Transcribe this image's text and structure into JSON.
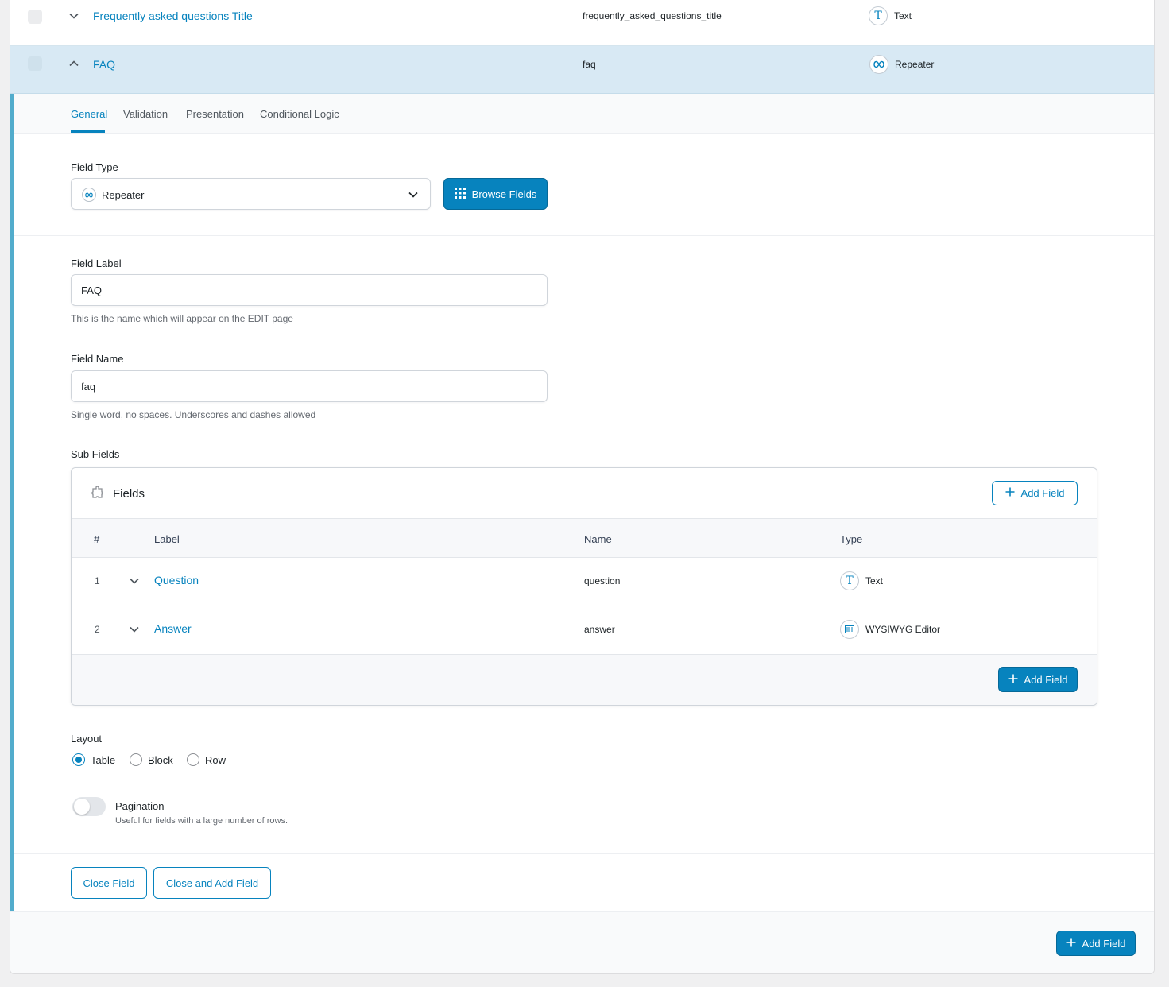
{
  "field_rows": [
    {
      "label": "Frequently asked questions Title",
      "name": "frequently_asked_questions_title",
      "type": "Text",
      "type_icon": "text-icon"
    },
    {
      "label": "FAQ",
      "name": "faq",
      "type": "Repeater",
      "type_icon": "repeater-icon"
    }
  ],
  "tabs": [
    "General",
    "Validation",
    "Presentation",
    "Conditional Logic"
  ],
  "general": {
    "field_type_label": "Field Type",
    "field_type_value": "Repeater",
    "browse_fields": "Browse Fields",
    "field_label_label": "Field Label",
    "field_label_value": "FAQ",
    "field_label_hint": "This is the name which will appear on the EDIT page",
    "field_name_label": "Field Name",
    "field_name_value": "faq",
    "field_name_hint": "Single word, no spaces. Underscores and dashes allowed",
    "sub_fields_label": "Sub Fields"
  },
  "sub_fields": {
    "title": "Fields",
    "add_field": "Add Field",
    "columns": {
      "num": "#",
      "label": "Label",
      "name": "Name",
      "type": "Type"
    },
    "rows": [
      {
        "num": "1",
        "label": "Question",
        "name": "question",
        "type": "Text",
        "type_icon": "text-icon"
      },
      {
        "num": "2",
        "label": "Answer",
        "name": "answer",
        "type": "WYSIWYG Editor",
        "type_icon": "wysiwyg-icon"
      }
    ]
  },
  "layout": {
    "label": "Layout",
    "options": [
      "Table",
      "Block",
      "Row"
    ],
    "selected": "Table"
  },
  "pagination": {
    "label": "Pagination",
    "hint": "Useful for fields with a large number of rows.",
    "enabled": false
  },
  "actions": {
    "close_field": "Close Field",
    "close_and_add": "Close and Add Field",
    "add_field": "Add Field"
  },
  "colors": {
    "accent": "#0783be",
    "row_highlight": "#d8e9f4",
    "edit_border": "#52accc"
  }
}
